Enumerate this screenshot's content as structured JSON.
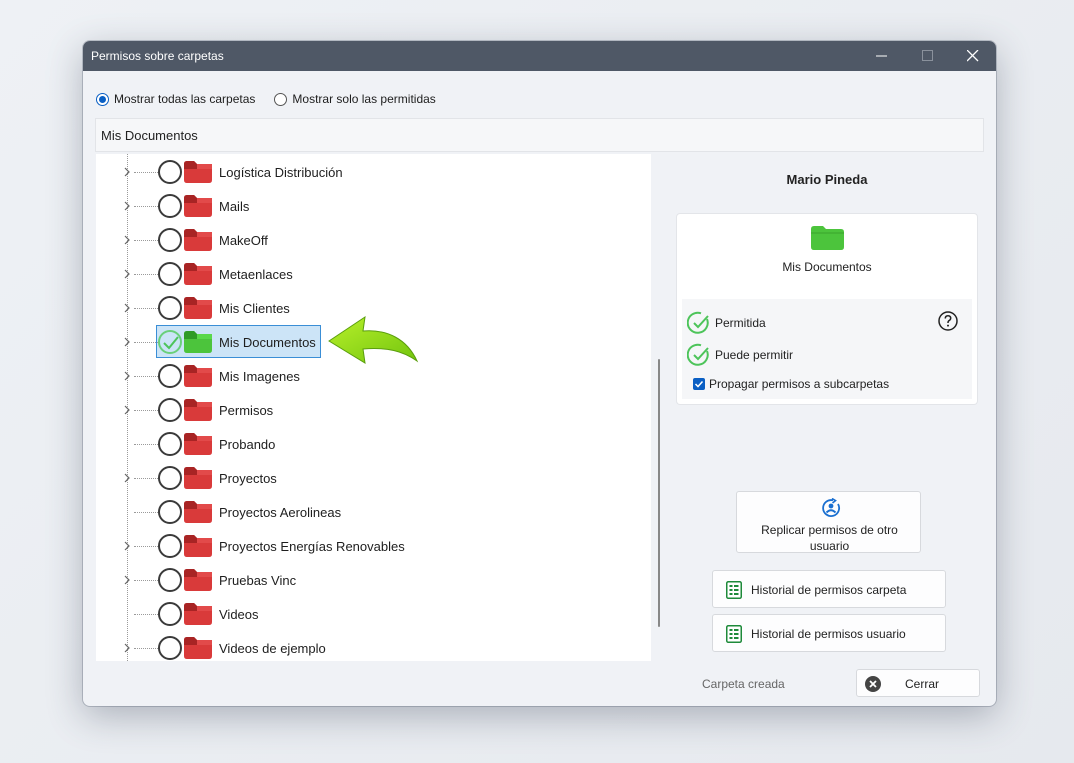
{
  "window": {
    "title": "Permisos sobre carpetas",
    "buttons": [
      "minimize-icon",
      "maximize-icon",
      "close-icon"
    ]
  },
  "filter": {
    "option_all": "Mostrar todas las carpetas",
    "option_allowed": "Mostrar solo las permitidas",
    "selected": "option_all"
  },
  "path": "Mis Documentos",
  "tree": {
    "items": [
      {
        "label": "Logística Distribución",
        "expandable": true,
        "allowed": false
      },
      {
        "label": "Mails",
        "expandable": true,
        "allowed": false
      },
      {
        "label": "MakeOff",
        "expandable": true,
        "allowed": false
      },
      {
        "label": "Metaenlaces",
        "expandable": true,
        "allowed": false
      },
      {
        "label": "Mis Clientes",
        "expandable": true,
        "allowed": false
      },
      {
        "label": "Mis Documentos",
        "expandable": true,
        "allowed": true,
        "selected": true
      },
      {
        "label": "Mis Imagenes",
        "expandable": true,
        "allowed": false
      },
      {
        "label": "Permisos",
        "expandable": true,
        "allowed": false
      },
      {
        "label": "Probando",
        "expandable": false,
        "allowed": false
      },
      {
        "label": "Proyectos",
        "expandable": true,
        "allowed": false
      },
      {
        "label": "Proyectos Aerolineas",
        "expandable": false,
        "allowed": false
      },
      {
        "label": "Proyectos Energías Renovables",
        "expandable": true,
        "allowed": false
      },
      {
        "label": "Pruebas Vinc",
        "expandable": true,
        "allowed": false
      },
      {
        "label": "Videos",
        "expandable": false,
        "allowed": false
      },
      {
        "label": "Videos de ejemplo",
        "expandable": true,
        "allowed": false
      }
    ]
  },
  "details": {
    "user_name": "Mario Pineda",
    "folder_name": "Mis Documentos",
    "permitida": "Permitida",
    "puede_permitir": "Puede permitir",
    "propagar": "Propagar permisos a subcarpetas",
    "propagar_checked": true,
    "replicate_button": "Replicar permisos de otro usuario",
    "history_folder_button": "Historial de permisos carpeta",
    "history_user_button": "Historial de permisos usuario",
    "created_label": "Carpeta creada"
  },
  "footer": {
    "close_button": "Cerrar"
  },
  "colors": {
    "titlebar": "#4f5866",
    "folder_red": "#d93a3a",
    "folder_green": "#4cc43c",
    "check_green": "#4dc45a",
    "accent_blue": "#0a5fc4",
    "selection": "#cce4f7"
  }
}
